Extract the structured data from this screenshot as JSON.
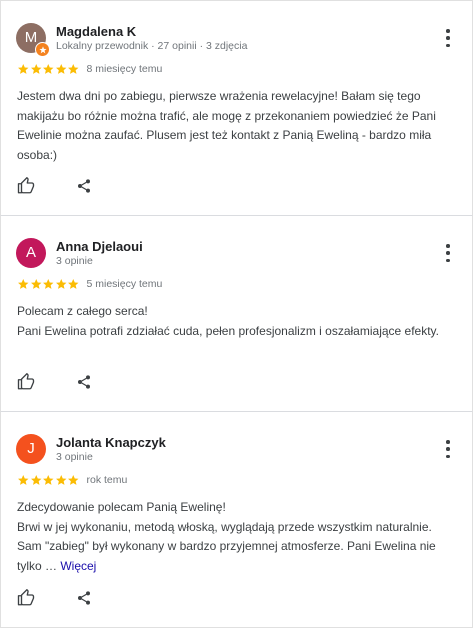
{
  "reviews": [
    {
      "author": "Magdalena K",
      "avatar_letter": "M",
      "avatar_color": "#8d6e63",
      "local_guide": true,
      "meta": "Lokalny przewodnik · 27 opinii · 3 zdjęcia",
      "stars": 5,
      "time": "8 miesięcy temu",
      "text_lines": [
        "Jestem dwa dni po zabiegu, pierwsze wrażenia rewelacyjne! Bałam się tego makijażu bo różnie można trafić, ale mogę z przekonaniem powiedzieć że Pani Ewelinie można zaufać. Plusem jest też kontakt z Panią Eweliną - bardzo miła osoba:)"
      ],
      "more_label": ""
    },
    {
      "author": "Anna Djelaoui",
      "avatar_letter": "A",
      "avatar_color": "#c2185b",
      "local_guide": false,
      "meta": "3 opinie",
      "stars": 5,
      "time": "5 miesięcy temu",
      "text_lines": [
        "Polecam z całego serca!",
        "Pani Ewelina potrafi zdziałać cuda, pełen profesjonalizm i oszałamiające efekty."
      ],
      "more_label": ""
    },
    {
      "author": "Jolanta Knapczyk",
      "avatar_letter": "J",
      "avatar_color": "#f4511e",
      "local_guide": false,
      "meta": "3 opinie",
      "stars": 5,
      "time": "rok temu",
      "text_lines": [
        "Zdecydowanie polecam Panią Ewelinę!",
        "Brwi w jej wykonaniu, metodą włoską, wyglądają przede wszystkim naturalnie. Sam \"zabieg\" był wykonany w bardzo przyjemnej atmosferze. Pani Ewelina nie tylko … "
      ],
      "more_label": "Więcej"
    }
  ],
  "colors": {
    "star": "#fbbc04",
    "link": "#1a0dab",
    "local_guide_badge": "#f4821f"
  },
  "icons": [
    "local-guide-badge-icon",
    "star-icon",
    "more-vert-icon",
    "thumb-up-icon",
    "share-icon"
  ]
}
